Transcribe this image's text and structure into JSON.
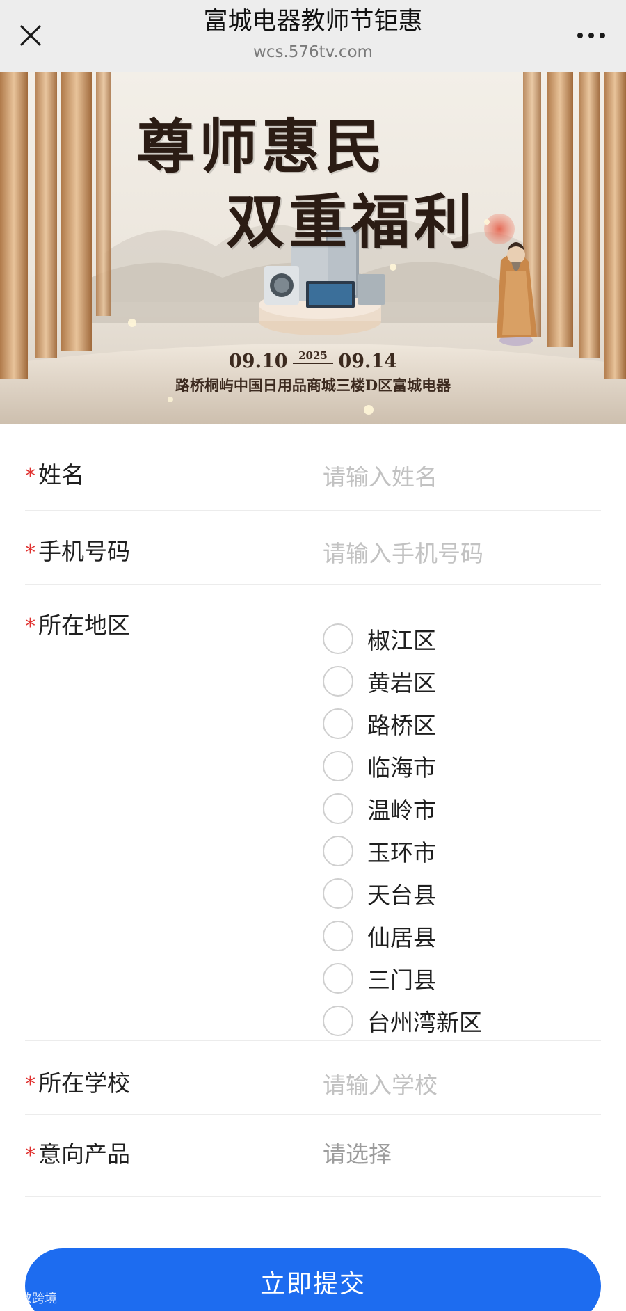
{
  "header": {
    "title": "富城电器教师节钜惠",
    "url": "wcs.576tv.com",
    "close_icon": "close-icon",
    "more_icon": "more-dots-icon"
  },
  "banner": {
    "title_line1": "尊师惠民",
    "title_line2": "双重福利",
    "date_start": "09.10",
    "year": "2025",
    "date_end": "09.14",
    "address": "路桥桐屿中国日用品商城三楼D区富城电器"
  },
  "form": {
    "required_mark": "*",
    "name": {
      "label": "姓名",
      "placeholder": "请输入姓名",
      "value": ""
    },
    "phone": {
      "label": "手机号码",
      "placeholder": "请输入手机号码",
      "value": ""
    },
    "region": {
      "label": "所在地区",
      "options": [
        "椒江区",
        "黄岩区",
        "路桥区",
        "临海市",
        "温岭市",
        "玉环市",
        "天台县",
        "仙居县",
        "三门县",
        "台州湾新区"
      ],
      "selected": null
    },
    "school": {
      "label": "所在学校",
      "placeholder": "请输入学校",
      "value": ""
    },
    "product": {
      "label": "意向产品",
      "value": "请选择"
    }
  },
  "submit": {
    "label": "立即提交"
  },
  "watermark": "大数跨境",
  "colors": {
    "accent": "#1d6cf0",
    "required": "#e0312f",
    "topbar": "#ededed"
  }
}
